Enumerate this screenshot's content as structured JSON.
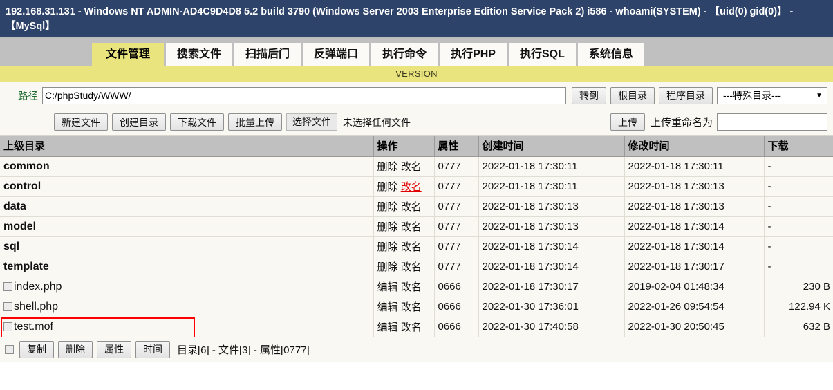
{
  "titlebar": {
    "text": "192.168.31.131 - Windows NT ADMIN-AD4C9D4D8 5.2 build 3790 (Windows Server 2003 Enterprise Edition Service Pack 2) i586 - whoami(SYSTEM) - 【uid(0) gid(0)】 - 【MySql】",
    "bg": "#2e4369",
    "fg": "#ffffff"
  },
  "tabs": [
    {
      "label": "文件管理",
      "active": true
    },
    {
      "label": "搜索文件",
      "active": false
    },
    {
      "label": "扫描后门",
      "active": false
    },
    {
      "label": "反弹端口",
      "active": false
    },
    {
      "label": "执行命令",
      "active": false
    },
    {
      "label": "执行PHP",
      "active": false
    },
    {
      "label": "执行SQL",
      "active": false
    },
    {
      "label": "系统信息",
      "active": false
    }
  ],
  "version_bar": {
    "text": "VERSION",
    "bg": "#eae47f"
  },
  "path_row": {
    "label": "路径",
    "value": "C:/phpStudy/WWW/",
    "placeholder": "",
    "goto_label": "转到",
    "root_label": "根目录",
    "program_label": "程序目录",
    "special_dir_selected": "---特殊目录---",
    "dropdown_icon": "chevron-down-icon"
  },
  "toolbar": {
    "new_file_label": "新建文件",
    "new_dir_label": "创建目录",
    "download_label": "下载文件",
    "batch_upload_label": "批量上传",
    "choose_file_label": "选择文件",
    "no_file_text": "未选择任何文件",
    "upload_label": "上传",
    "rename_label": "上传重命名为",
    "rename_value": "",
    "rename_placeholder": ""
  },
  "table": {
    "headers": {
      "name": "上级目录",
      "op": "操作",
      "attr": "属性",
      "ctime": "创建时间",
      "mtime": "修改时间",
      "download": "下载"
    },
    "rows": [
      {
        "name": "common",
        "type": "dir",
        "op1": "删除",
        "op2": "改名",
        "op2_red": false,
        "attr": "0777",
        "ctime": "2022-01-18 17:30:11",
        "mtime": "2022-01-18 17:30:11",
        "size": "-",
        "highlight": false
      },
      {
        "name": "control",
        "type": "dir",
        "op1": "删除",
        "op2": "改名",
        "op2_red": true,
        "attr": "0777",
        "ctime": "2022-01-18 17:30:11",
        "mtime": "2022-01-18 17:30:13",
        "size": "-",
        "highlight": false
      },
      {
        "name": "data",
        "type": "dir",
        "op1": "删除",
        "op2": "改名",
        "op2_red": false,
        "attr": "0777",
        "ctime": "2022-01-18 17:30:13",
        "mtime": "2022-01-18 17:30:13",
        "size": "-",
        "highlight": false
      },
      {
        "name": "model",
        "type": "dir",
        "op1": "删除",
        "op2": "改名",
        "op2_red": false,
        "attr": "0777",
        "ctime": "2022-01-18 17:30:13",
        "mtime": "2022-01-18 17:30:14",
        "size": "-",
        "highlight": false
      },
      {
        "name": "sql",
        "type": "dir",
        "op1": "删除",
        "op2": "改名",
        "op2_red": false,
        "attr": "0777",
        "ctime": "2022-01-18 17:30:14",
        "mtime": "2022-01-18 17:30:14",
        "size": "-",
        "highlight": false
      },
      {
        "name": "template",
        "type": "dir",
        "op1": "删除",
        "op2": "改名",
        "op2_red": false,
        "attr": "0777",
        "ctime": "2022-01-18 17:30:14",
        "mtime": "2022-01-18 17:30:17",
        "size": "-",
        "highlight": false
      },
      {
        "name": "index.php",
        "type": "file",
        "op1": "编辑",
        "op2": "改名",
        "op2_red": false,
        "attr": "0666",
        "ctime": "2022-01-18 17:30:17",
        "mtime": "2019-02-04 01:48:34",
        "size": "230 B",
        "highlight": false
      },
      {
        "name": "shell.php",
        "type": "file",
        "op1": "编辑",
        "op2": "改名",
        "op2_red": false,
        "attr": "0666",
        "ctime": "2022-01-30 17:36:01",
        "mtime": "2022-01-26 09:54:54",
        "size": "122.94 K",
        "highlight": false
      },
      {
        "name": "test.mof",
        "type": "file",
        "op1": "编辑",
        "op2": "改名",
        "op2_red": false,
        "attr": "0666",
        "ctime": "2022-01-30 17:40:58",
        "mtime": "2022-01-30 20:50:45",
        "size": "632 B",
        "highlight": true
      }
    ]
  },
  "footer": {
    "copy_label": "复制",
    "delete_label": "删除",
    "attr_label": "属性",
    "time_label": "时间",
    "status": "目录[6] - 文件[3] - 属性[0777]"
  },
  "colors": {
    "accent_yellow": "#eae47f",
    "titlebar_blue": "#2e4369",
    "highlight_red": "#ff0000",
    "path_label_green": "#1f6b2f"
  }
}
